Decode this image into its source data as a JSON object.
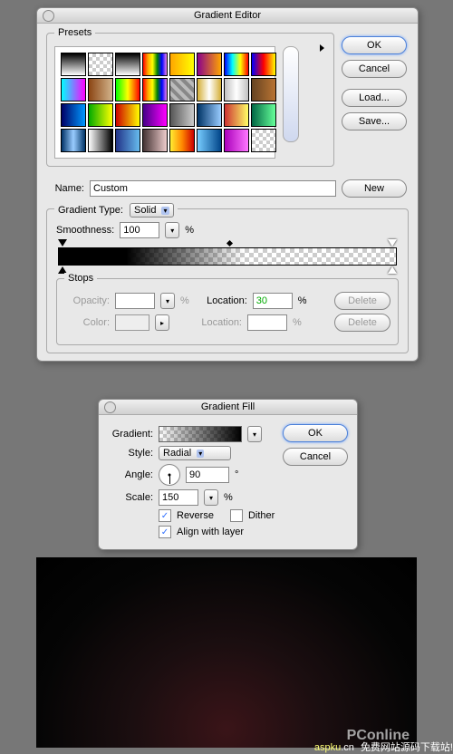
{
  "editor": {
    "title": "Gradient Editor",
    "presets_label": "Presets",
    "name_label": "Name:",
    "name_value": "Custom",
    "type_label": "Gradient Type:",
    "type_value": "Solid",
    "smooth_label": "Smoothness:",
    "smooth_value": "100",
    "percent": "%",
    "stops_label": "Stops",
    "opacity_label": "Opacity:",
    "opacity_value": "",
    "color_label": "Color:",
    "location_label": "Location:",
    "location1_value": "30",
    "location2_value": "",
    "delete_label": "Delete",
    "buttons": {
      "ok": "OK",
      "cancel": "Cancel",
      "load": "Load...",
      "save": "Save...",
      "new": "New"
    },
    "swatch_bg": [
      "linear-gradient(#000,#fff)",
      "repeating-conic-gradient(#ccc 0 25%,#fff 0 50%) 0 0/8px 8px",
      "linear-gradient(#000,#fff)",
      "linear-gradient(90deg,red,orange,yellow,green,blue,violet)",
      "linear-gradient(90deg,orange,yellow)",
      "linear-gradient(90deg,#8b008b,#ffa500)",
      "linear-gradient(90deg,#00f,#0ff,#ff0,#f00)",
      "linear-gradient(90deg,#00f,#f00,#ff0)",
      "linear-gradient(90deg,#0ff,#f0f)",
      "linear-gradient(90deg,#8b4513,#d2b48c)",
      "linear-gradient(90deg,#0f0,#ff0,#f00)",
      "linear-gradient(90deg,red,orange,yellow,green,blue,violet)",
      "repeating-linear-gradient(45deg,#888 0 4px,#bbb 4px 8px)",
      "linear-gradient(90deg,#d4af37,#fff,#d4af37)",
      "linear-gradient(90deg,#c0c0c0,#fff,#c0c0c0)",
      "linear-gradient(90deg,#654321,#b87333)",
      "linear-gradient(90deg,#006,#09f)",
      "linear-gradient(90deg,#0a0,#ff0)",
      "linear-gradient(90deg,#c00,#ff0)",
      "linear-gradient(90deg,#408,#f0f)",
      "linear-gradient(90deg,#555,#ccc)",
      "linear-gradient(90deg,#036,#9cf)",
      "linear-gradient(90deg,#c33,#ff6)",
      "linear-gradient(90deg,#064,#6f9)",
      "linear-gradient(90deg,#036,#9cf,#036)",
      "linear-gradient(90deg,#fff,#000)",
      "linear-gradient(90deg,#238,#6be)",
      "linear-gradient(90deg,#433,#ecc)",
      "linear-gradient(90deg,#fe3,#f80,#c00)",
      "linear-gradient(90deg,#7cf,#048)",
      "linear-gradient(90deg,#a0b,#f7f)",
      "repeating-conic-gradient(#ccc 0 25%,#fff 0 50%) 0 0/8px 8px"
    ]
  },
  "fill": {
    "title": "Gradient Fill",
    "gradient_label": "Gradient:",
    "style_label": "Style:",
    "style_value": "Radial",
    "angle_label": "Angle:",
    "angle_value": "90",
    "degree": "°",
    "scale_label": "Scale:",
    "scale_value": "150",
    "percent": "%",
    "reverse_label": "Reverse",
    "dither_label": "Dither",
    "align_label": "Align with layer",
    "reverse_checked": true,
    "dither_checked": false,
    "align_checked": true,
    "buttons": {
      "ok": "OK",
      "cancel": "Cancel"
    }
  },
  "watermark": {
    "brand": "PConline",
    "site": "aspku",
    "suffix": ".cn",
    "tag": "免费网站源码下载站!"
  }
}
